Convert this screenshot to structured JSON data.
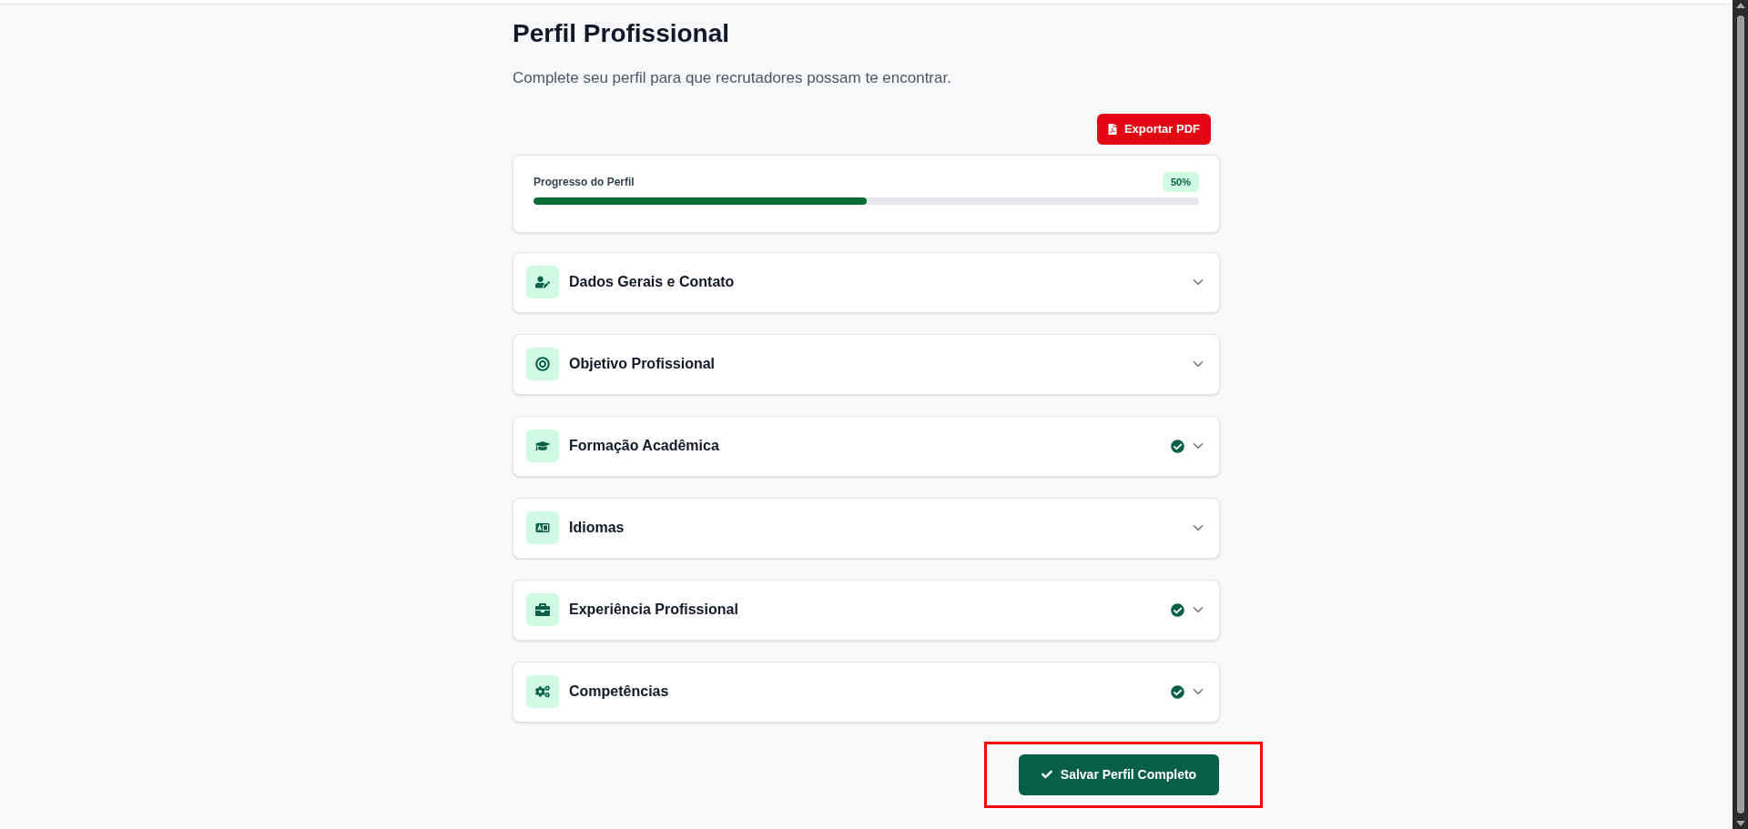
{
  "header": {
    "title": "Perfil Profissional",
    "subtitle": "Complete seu perfil para que recrutadores possam te encontrar."
  },
  "export_button": {
    "label": "Exportar PDF"
  },
  "progress": {
    "label": "Progresso do Perfil",
    "badge": "50%",
    "level": 0.5
  },
  "sections": [
    {
      "title": "Dados Gerais e Contato",
      "kind": "contact",
      "complete": false,
      "expanded": false
    },
    {
      "title": "Objetivo Profissional",
      "kind": "objective",
      "complete": false,
      "expanded": false
    },
    {
      "title": "Formação Acadêmica",
      "kind": "education",
      "complete": true,
      "expanded": false
    },
    {
      "title": "Idiomas",
      "kind": "languages",
      "complete": false,
      "expanded": false
    },
    {
      "title": "Experiência Profissional",
      "kind": "experience",
      "complete": true,
      "expanded": false
    },
    {
      "title": "Competências",
      "kind": "skills",
      "complete": true,
      "expanded": false
    }
  ],
  "save_button": {
    "label": "Salvar Perfil Completo",
    "highlighted": true
  }
}
